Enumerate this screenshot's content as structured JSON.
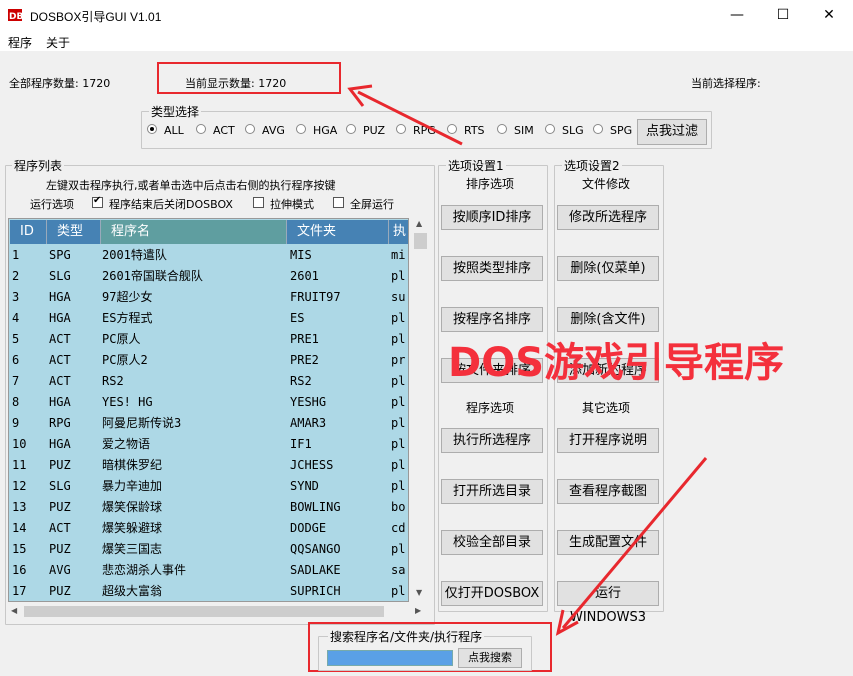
{
  "window": {
    "title": "DOSBOX引导GUI V1.01",
    "minimize": "—",
    "maximize": "☐",
    "close": "✕"
  },
  "menu": [
    "程序",
    "关于"
  ],
  "stats": {
    "total": "全部程序数量: 1720",
    "shown": "当前显示数量: 1720",
    "selected": "当前选择程序:"
  },
  "type_filter": {
    "legend": "类型选择",
    "options": [
      "ALL",
      "ACT",
      "AVG",
      "HGA",
      "PUZ",
      "RPG",
      "RTS",
      "SIM",
      "SLG",
      "SPG"
    ],
    "selected": "ALL",
    "button": "点我过滤"
  },
  "program_list": {
    "legend": "程序列表",
    "hint": "左键双击程序执行,或者单击选中后点击右侧的执行程序按键",
    "run_options_label": "运行选项",
    "checkboxes": [
      {
        "label": "程序结束后关闭DOSBOX",
        "checked": true
      },
      {
        "label": "拉伸模式",
        "checked": false
      },
      {
        "label": "全屏运行",
        "checked": false
      }
    ],
    "columns": [
      "ID",
      "类型",
      "程序名",
      "文件夹",
      "执"
    ],
    "rows": [
      [
        "1",
        "SPG",
        "2001特遣队",
        "MIS",
        "mi"
      ],
      [
        "2",
        "SLG",
        "2601帝国联合舰队",
        "2601",
        "pl"
      ],
      [
        "3",
        "HGA",
        "97超少女",
        "FRUIT97",
        "su"
      ],
      [
        "4",
        "HGA",
        "ES方程式",
        "ES",
        "pl"
      ],
      [
        "5",
        "ACT",
        "PC原人",
        "PRE1",
        "pl"
      ],
      [
        "6",
        "ACT",
        "PC原人2",
        "PRE2",
        "pr"
      ],
      [
        "7",
        "ACT",
        "RS2",
        "RS2",
        "pl"
      ],
      [
        "8",
        "HGA",
        "YES! HG",
        "YESHG",
        "pl"
      ],
      [
        "9",
        "RPG",
        "阿曼尼斯传说3",
        "AMAR3",
        "pl"
      ],
      [
        "10",
        "HGA",
        "爱之物语",
        "IF1",
        "pl"
      ],
      [
        "11",
        "PUZ",
        "暗棋侏罗纪",
        "JCHESS",
        "pl"
      ],
      [
        "12",
        "SLG",
        "暴力辛迪加",
        "SYND",
        "pl"
      ],
      [
        "13",
        "PUZ",
        "爆笑保龄球",
        "BOWLING",
        "bo"
      ],
      [
        "14",
        "ACT",
        "爆笑躲避球",
        "DODGE",
        "cd"
      ],
      [
        "15",
        "PUZ",
        "爆笑三国志",
        "QQSANGO",
        "pl"
      ],
      [
        "16",
        "AVG",
        "悲恋湖杀人事件",
        "SADLAKE",
        "sa"
      ],
      [
        "17",
        "PUZ",
        "超级大富翁",
        "SUPRICH",
        "pl"
      ]
    ]
  },
  "options1": {
    "legend": "选项设置1",
    "sort_title": "排序选项",
    "sort_buttons": [
      "按顺序ID排序",
      "按照类型排序",
      "按程序名排序",
      "按文件夹排序"
    ],
    "prog_title": "程序选项",
    "prog_buttons": [
      "执行所选程序",
      "打开所选目录",
      "校验全部目录",
      "仅打开DOSBOX"
    ]
  },
  "options2": {
    "legend": "选项设置2",
    "file_title": "文件修改",
    "file_buttons": [
      "修改所选程序",
      "删除(仅菜单)",
      "删除(含文件)",
      "添加新的程序"
    ],
    "other_title": "其它选项",
    "other_buttons": [
      "打开程序说明",
      "查看程序截图",
      "生成配置文件",
      "运行WINDOWS3"
    ]
  },
  "search": {
    "legend": "搜索程序名/文件夹/执行程序",
    "value": "",
    "button": "点我搜索"
  },
  "overlay": {
    "text": "DOS游戏引导程序",
    "color": "#f4303c"
  },
  "colors": {
    "grid_bg": "#add8e6",
    "header_bg": "#4682b4",
    "annotation": "#e8282e"
  }
}
